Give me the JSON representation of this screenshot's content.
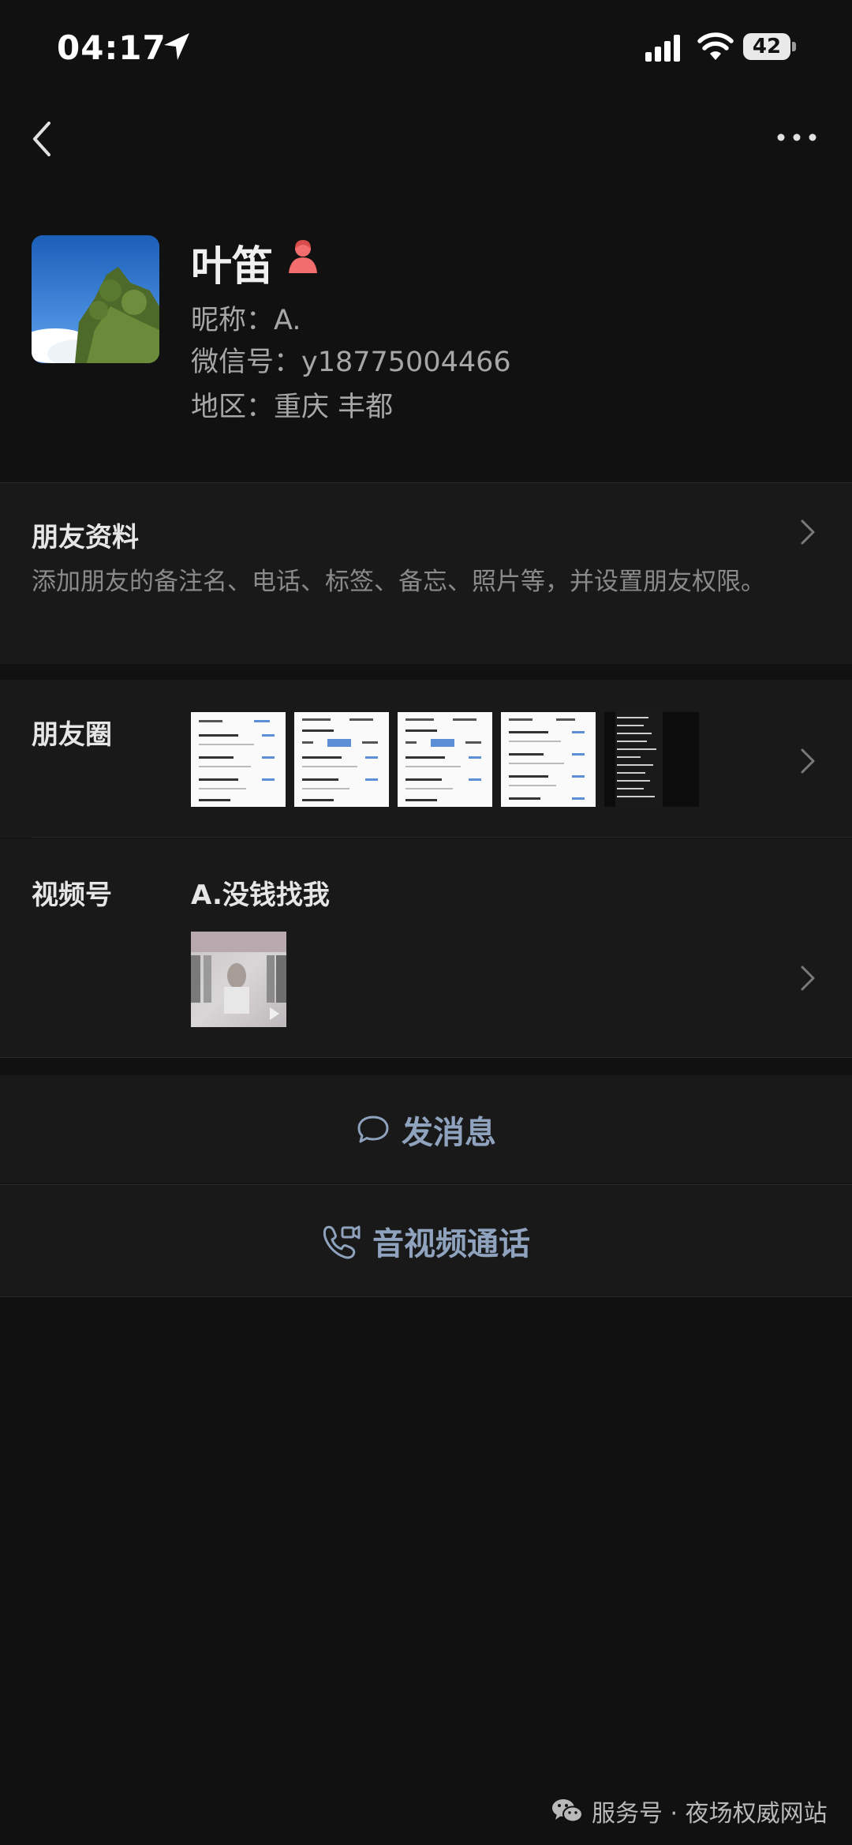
{
  "status_bar": {
    "time": "04:17",
    "battery": "42"
  },
  "profile": {
    "name": "叶笛",
    "nickname": "昵称：A.",
    "wechat_id": "微信号：y18775004466",
    "region": "地区：重庆 丰都"
  },
  "friend_info": {
    "title": "朋友资料",
    "description": "添加朋友的备注名、电话、标签、备忘、照片等，并设置朋友权限。"
  },
  "moments": {
    "title": "朋友圈"
  },
  "channels": {
    "title": "视频号",
    "account_name": "A.没钱找我"
  },
  "actions": {
    "message": "发消息",
    "call": "音视频通话"
  },
  "footer": {
    "text": "服务号 · 夜场权威网站"
  },
  "icons": {
    "back": "chevron-left-icon",
    "more": "more-dots-icon",
    "gender": "female-icon",
    "message": "chat-bubble-icon",
    "call": "video-call-icon"
  },
  "colors": {
    "background": "#111111",
    "section": "#191919",
    "action_text": "#8fa3bf",
    "gender_female": "#f26d6d"
  }
}
